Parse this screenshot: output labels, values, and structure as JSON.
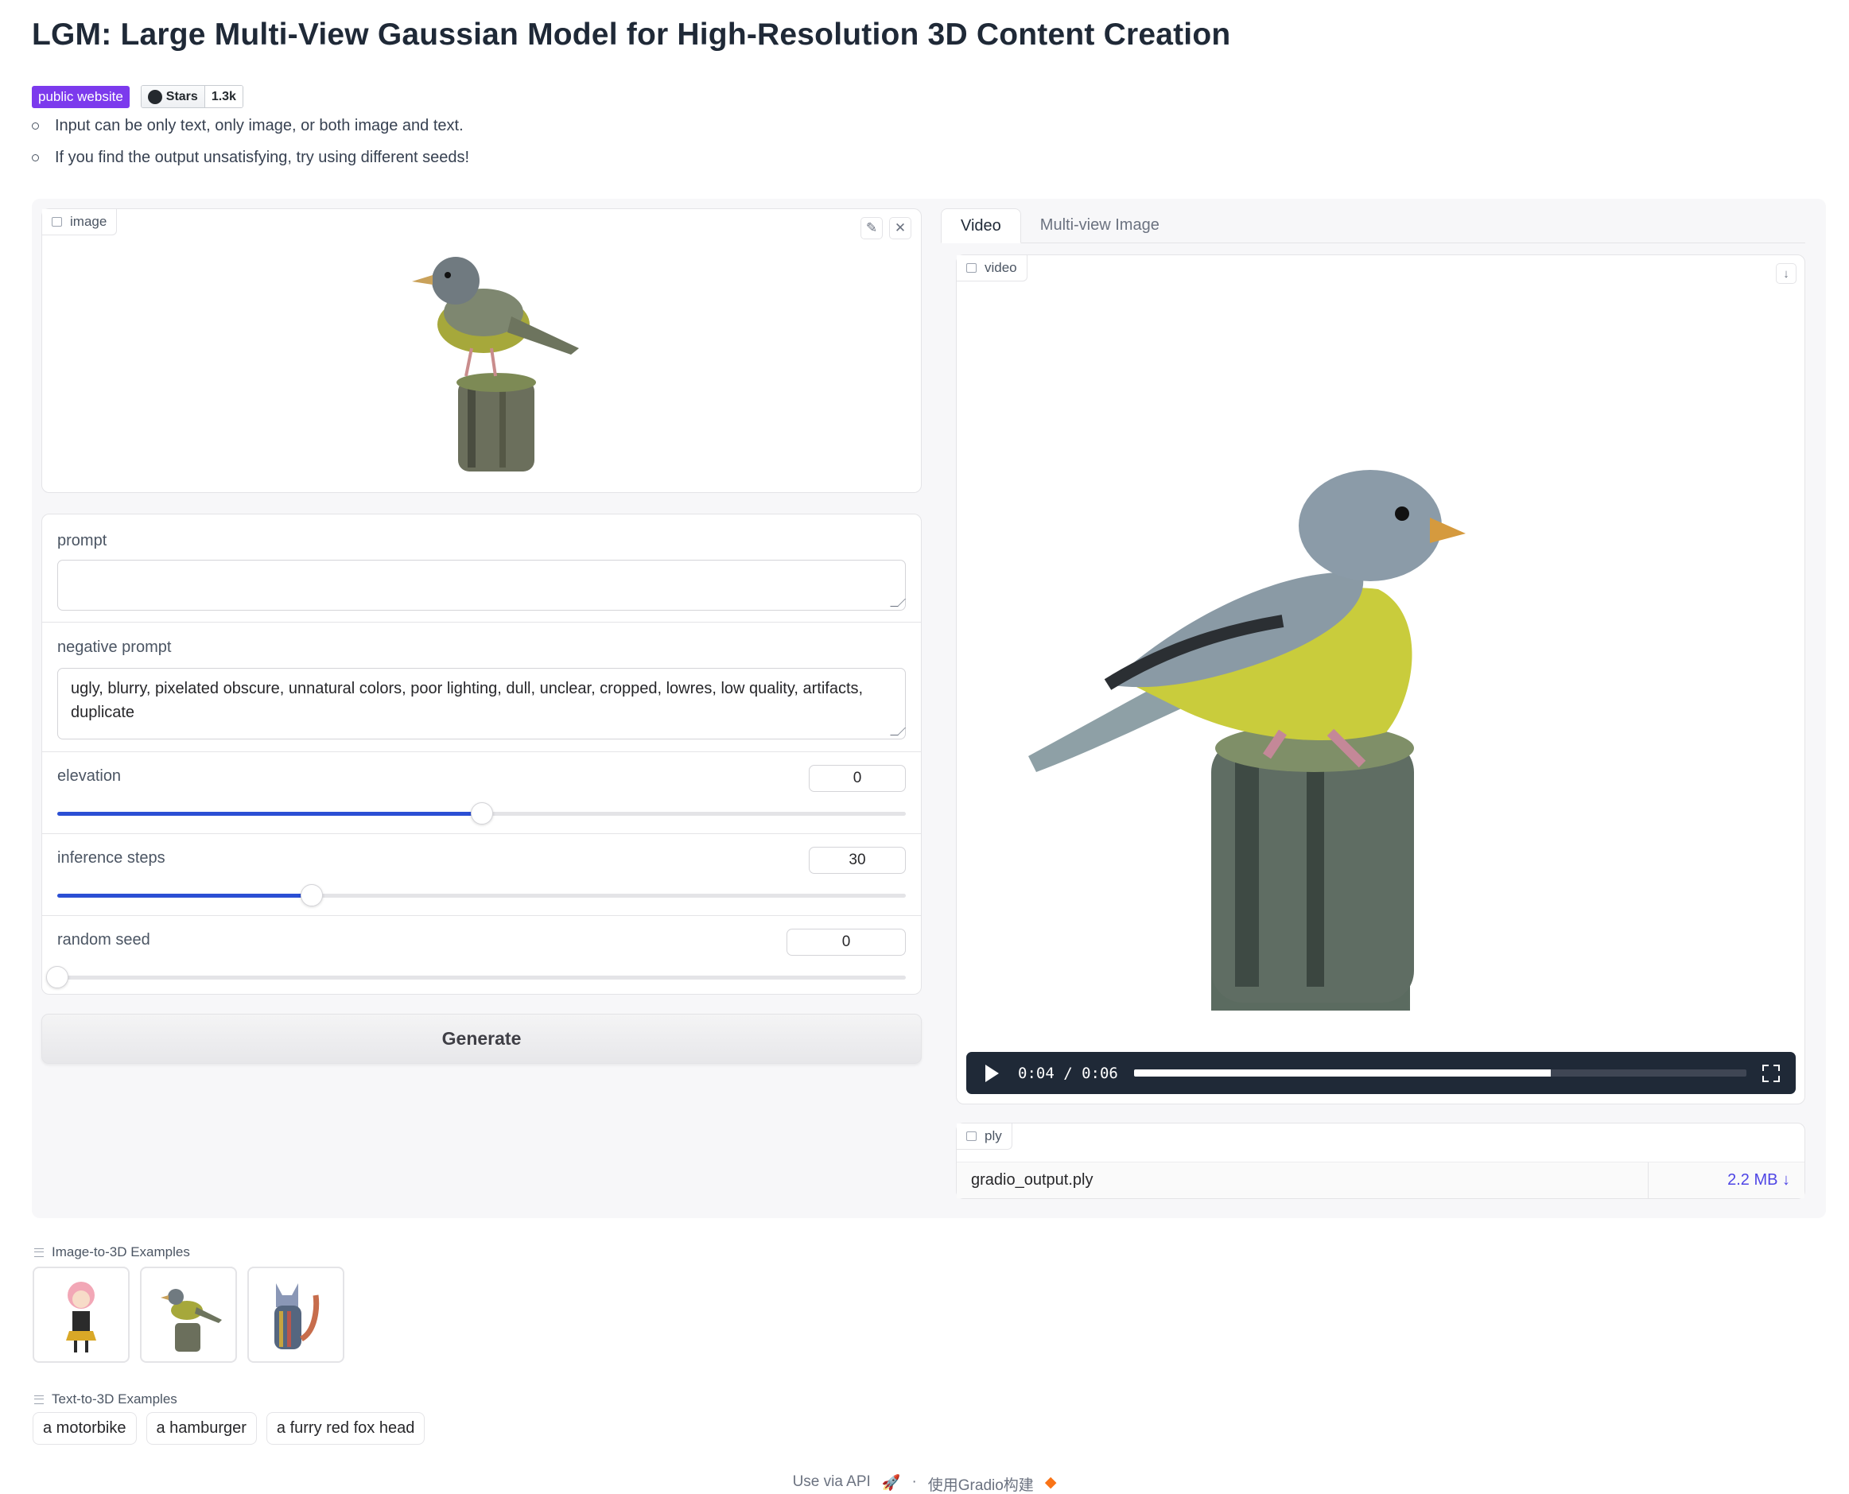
{
  "title": "LGM: Large Multi-View Gaussian Model for High-Resolution 3D Content Creation",
  "badges": {
    "public": "public website",
    "stars_label": "Stars",
    "stars_count": "1.3k"
  },
  "bullets": [
    "Input can be only text, only image, or both image and text.",
    "If you find the output unsatisfying, try using different seeds!"
  ],
  "image_input": {
    "label": "image"
  },
  "prompt": {
    "label": "prompt",
    "value": ""
  },
  "negative_prompt": {
    "label": "negative prompt",
    "value": "ugly, blurry, pixelated obscure, unnatural colors, poor lighting, dull, unclear, cropped, lowres, low quality, artifacts, duplicate"
  },
  "elevation": {
    "label": "elevation",
    "value": "0",
    "fraction": 0.5
  },
  "inference_steps": {
    "label": "inference steps",
    "value": "30",
    "fraction": 0.3
  },
  "random_seed": {
    "label": "random seed",
    "value": "0",
    "fraction": 0.0
  },
  "generate_label": "Generate",
  "tabs": [
    "Video",
    "Multi-view Image"
  ],
  "video": {
    "label": "video",
    "time": "0:04 / 0:06",
    "progress": 0.68
  },
  "file": {
    "label": "ply",
    "name": "gradio_output.ply",
    "size": "2.2 MB ↓"
  },
  "examples": {
    "image_label": "Image-to-3D Examples",
    "text_label": "Text-to-3D Examples",
    "text_items": [
      "a motorbike",
      "a hamburger",
      "a furry red fox head"
    ]
  },
  "footer": {
    "api": "Use via API",
    "built": "使用Gradio构建"
  },
  "colors": {
    "accent": "#2b4fd4",
    "badge": "#7c3aed",
    "link": "#4f46e5"
  }
}
